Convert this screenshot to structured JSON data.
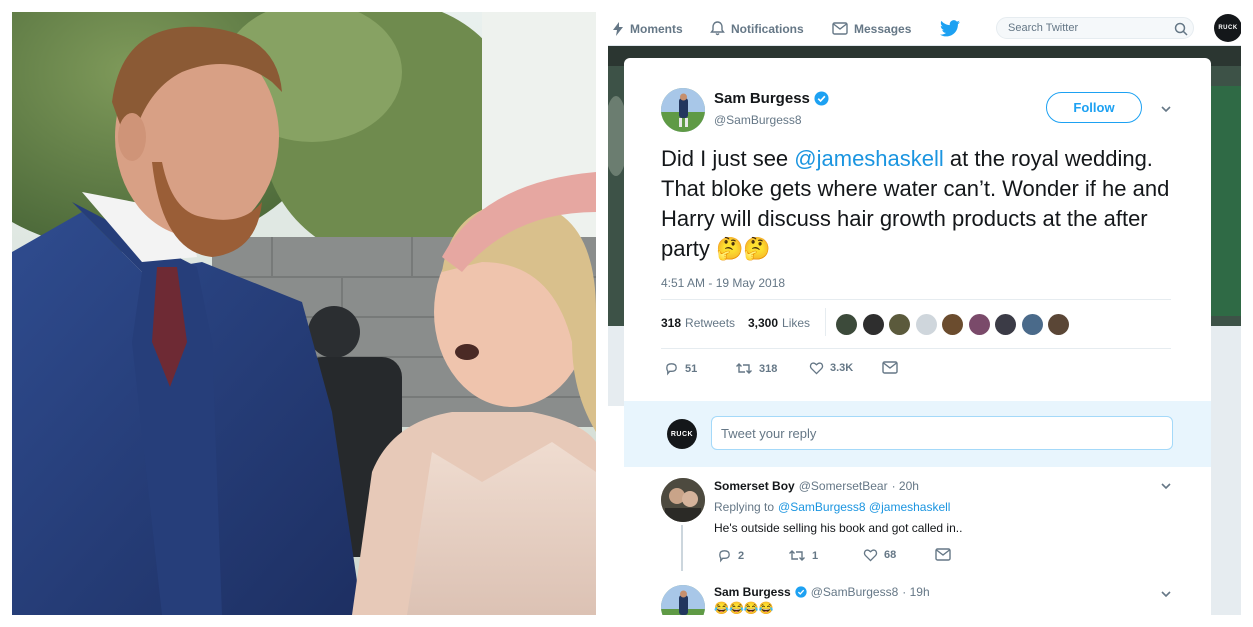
{
  "nav": {
    "moments": "Moments",
    "notifications": "Notifications",
    "messages": "Messages",
    "search_placeholder": "Search Twitter",
    "account_avatar_text": "RUCK"
  },
  "tweet": {
    "display_name": "Sam Burgess",
    "handle": "@SamBurgess8",
    "follow_label": "Follow",
    "text_part1": "Did I just see ",
    "mention": "@jameshaskell",
    "text_part2": " at the royal wedding. That bloke gets where water can’t. Wonder if he and Harry will discuss hair growth products at the after party ",
    "emojis": "🤔🤔",
    "timestamp": "4:51 AM - 19 May 2018",
    "retweets_count": "318",
    "retweets_label": "Retweets",
    "likes_count": "3,300",
    "likes_label": "Likes",
    "reply_count": "51",
    "retweet_count": "318",
    "like_count": "3.3K"
  },
  "reply_box": {
    "avatar_text": "RUCK",
    "placeholder": "Tweet your reply"
  },
  "replies": [
    {
      "display_name": "Somerset Boy",
      "handle": "@SomersetBear",
      "time": "· 20h",
      "replying_to_label": "Replying to",
      "replying_to": "@SamBurgess8 @jameshaskell",
      "text": "He's outside selling his book and got called in..",
      "reply_count": "2",
      "retweet_count": "1",
      "like_count": "68"
    },
    {
      "display_name": "Sam Burgess",
      "handle": "@SamBurgess8",
      "time": "· 19h",
      "text": "😂😂😂😂"
    }
  ],
  "colors": {
    "accent": "#1da1f2",
    "link": "#1b95e0",
    "text": "#14171a",
    "muted": "#657786"
  }
}
